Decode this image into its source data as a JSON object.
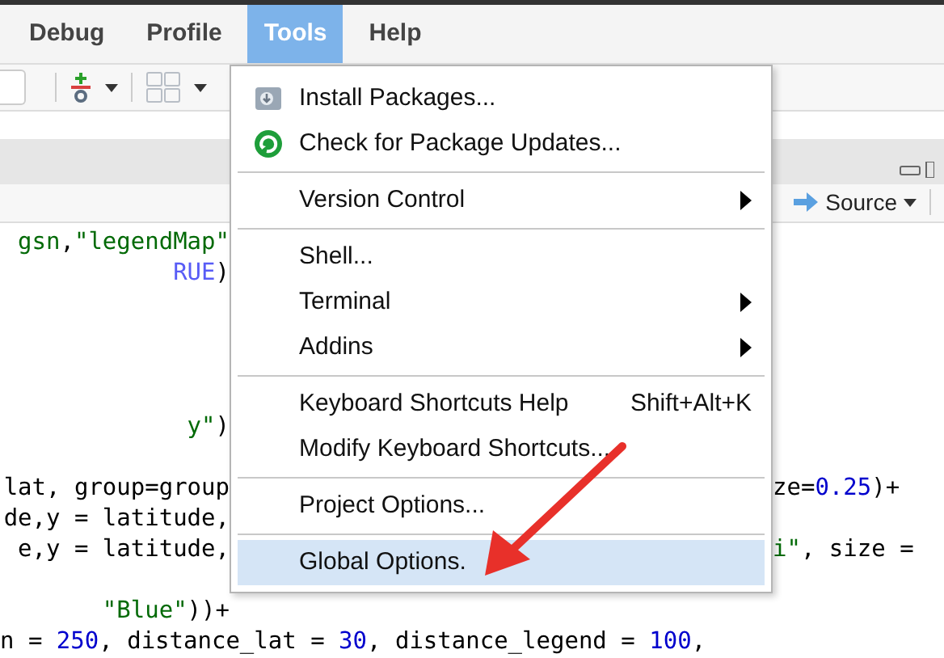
{
  "menubar": [
    {
      "label": "Debug",
      "selected": false
    },
    {
      "label": "Profile",
      "selected": false
    },
    {
      "label": "Tools",
      "selected": true
    },
    {
      "label": "Help",
      "selected": false
    }
  ],
  "editor": {
    "source_button": "Source",
    "lines": [
      {
        "kind": "code",
        "left": [
          {
            "t": "gsn",
            "kind": "string"
          },
          {
            "t": ",",
            "kind": "plain"
          },
          {
            "t": "\"legendMap\"",
            "kind": "string"
          }
        ]
      },
      {
        "kind": "code",
        "left": [
          {
            "t": "RUE",
            "kind": "constant"
          },
          {
            "t": ")",
            "kind": "plain"
          }
        ]
      },
      {
        "kind": "blank"
      },
      {
        "kind": "blank"
      },
      {
        "kind": "blank"
      },
      {
        "kind": "blank"
      },
      {
        "kind": "code",
        "left": [
          {
            "t": "y\"",
            "kind": "string"
          },
          {
            "t": ")",
            "kind": "plain"
          }
        ]
      },
      {
        "kind": "blank"
      },
      {
        "kind": "code",
        "left": [
          {
            "t": "lat, group=group",
            "kind": "plain"
          }
        ],
        "right": [
          {
            "t": "ze=",
            "kind": "plain"
          },
          {
            "t": "0.25",
            "kind": "number"
          },
          {
            "t": ")+",
            "kind": "plain"
          }
        ]
      },
      {
        "kind": "code",
        "left": [
          {
            "t": "de,y = latitude,",
            "kind": "plain"
          }
        ]
      },
      {
        "kind": "code",
        "left": [
          {
            "t": "e,y = latitude,",
            "kind": "plain"
          }
        ],
        "right": [
          {
            "t": "i\"",
            "kind": "string"
          },
          {
            "t": ", size =",
            "kind": "plain"
          }
        ]
      },
      {
        "kind": "blank"
      },
      {
        "kind": "code",
        "left": [
          {
            "t": " \"Blue\"",
            "kind": "string"
          },
          {
            "t": "))+",
            "kind": "plain"
          }
        ]
      },
      {
        "kind": "full",
        "left": [
          {
            "t": "n = ",
            "kind": "plain"
          },
          {
            "t": "250",
            "kind": "number"
          },
          {
            "t": ", distance_lat = ",
            "kind": "plain"
          },
          {
            "t": "30",
            "kind": "number"
          },
          {
            "t": ", distance_legend = ",
            "kind": "plain"
          },
          {
            "t": "100",
            "kind": "number"
          },
          {
            "t": ",",
            "kind": "plain"
          }
        ]
      }
    ]
  },
  "tools_menu": [
    {
      "kind": "item",
      "label": "Install Packages...",
      "submenu": false,
      "selected": false
    },
    {
      "kind": "item",
      "label": "Check for Package Updates...",
      "submenu": false,
      "selected": false
    },
    {
      "kind": "separator"
    },
    {
      "kind": "item",
      "label": "Version Control",
      "submenu": true,
      "selected": false
    },
    {
      "kind": "separator"
    },
    {
      "kind": "item",
      "label": "Shell...",
      "submenu": false,
      "selected": false
    },
    {
      "kind": "item",
      "label": "Terminal",
      "submenu": true,
      "selected": false
    },
    {
      "kind": "item",
      "label": "Addins",
      "submenu": true,
      "selected": false
    },
    {
      "kind": "separator"
    },
    {
      "kind": "item",
      "label": "Keyboard Shortcuts Help",
      "shortcut": "Shift+Alt+K",
      "submenu": false,
      "selected": false
    },
    {
      "kind": "item",
      "label": "Modify Keyboard Shortcuts...",
      "submenu": false,
      "selected": false
    },
    {
      "kind": "separator"
    },
    {
      "kind": "item",
      "label": "Project Options...",
      "submenu": false,
      "selected": false
    },
    {
      "kind": "separator"
    },
    {
      "kind": "item",
      "label": "Global Options.",
      "submenu": false,
      "selected": true
    }
  ]
}
